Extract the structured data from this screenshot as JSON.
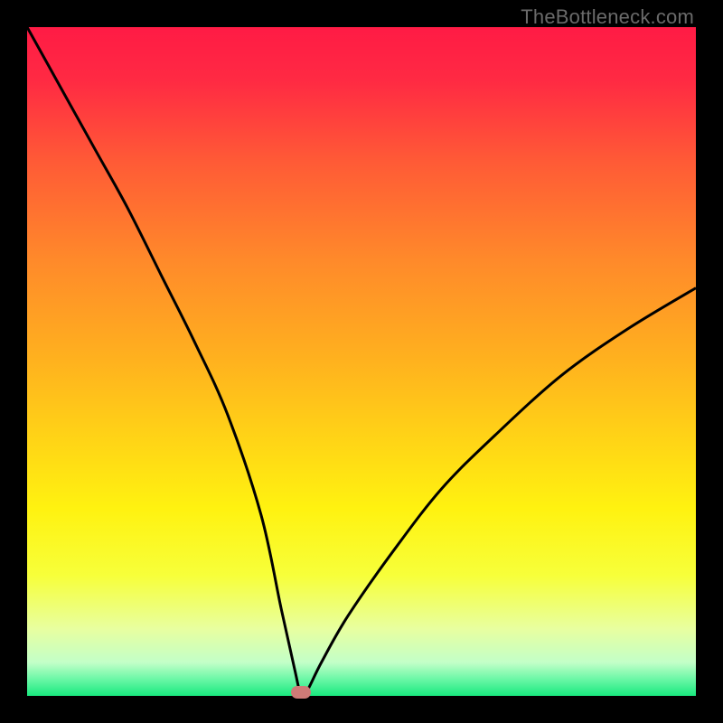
{
  "watermark": "TheBottleneck.com",
  "chart_data": {
    "type": "line",
    "title": "",
    "xlabel": "",
    "ylabel": "",
    "xlim": [
      0,
      100
    ],
    "ylim": [
      0,
      100
    ],
    "grid": false,
    "legend": false,
    "series": [
      {
        "name": "bottleneck-curve",
        "x": [
          0,
          5,
          10,
          15,
          20,
          25,
          30,
          35,
          38,
          40,
          41,
          42,
          44,
          48,
          55,
          62,
          70,
          80,
          90,
          100
        ],
        "values": [
          100,
          91,
          82,
          73,
          63,
          53,
          42,
          27,
          13,
          4,
          0,
          1,
          5,
          12,
          22,
          31,
          39,
          48,
          55,
          61
        ]
      }
    ],
    "marker": {
      "x": 41,
      "y": 0,
      "color": "#cf7b77"
    },
    "gradient_stops": [
      {
        "offset": 0.0,
        "color": "#ff1b45"
      },
      {
        "offset": 0.08,
        "color": "#ff2a43"
      },
      {
        "offset": 0.2,
        "color": "#ff5a36"
      },
      {
        "offset": 0.35,
        "color": "#ff8a2a"
      },
      {
        "offset": 0.5,
        "color": "#ffb21e"
      },
      {
        "offset": 0.62,
        "color": "#ffd516"
      },
      {
        "offset": 0.72,
        "color": "#fff210"
      },
      {
        "offset": 0.82,
        "color": "#f7ff3a"
      },
      {
        "offset": 0.9,
        "color": "#e8ffa0"
      },
      {
        "offset": 0.95,
        "color": "#c3ffc8"
      },
      {
        "offset": 0.975,
        "color": "#6bf7a6"
      },
      {
        "offset": 1.0,
        "color": "#19e97f"
      }
    ]
  }
}
